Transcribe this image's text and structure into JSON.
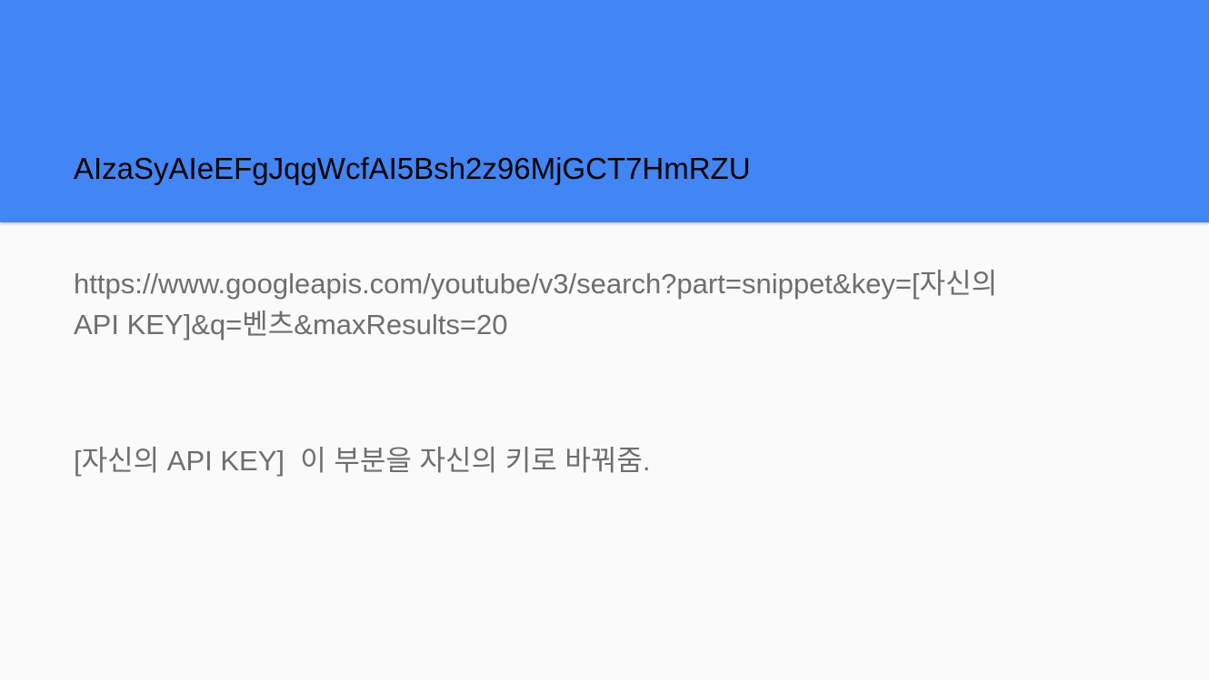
{
  "slide": {
    "title": "AIzaSyAIeEFgJqgWcfAI5Bsh2z96MjGCT7HmRZU",
    "url_line_1": "https://www.googleapis.com/youtube/v3/search?part=snippet&key=[자신의",
    "url_line_2": "API KEY]&q=벤츠&maxResults=20",
    "note": "[자신의 API KEY]  이 부분을 자신의 키로 바꿔줌."
  },
  "colors": {
    "header_background": "#4285f4",
    "slide_background": "#fafafa",
    "body_text": "#6e6e6e",
    "title_text": "#000000"
  }
}
